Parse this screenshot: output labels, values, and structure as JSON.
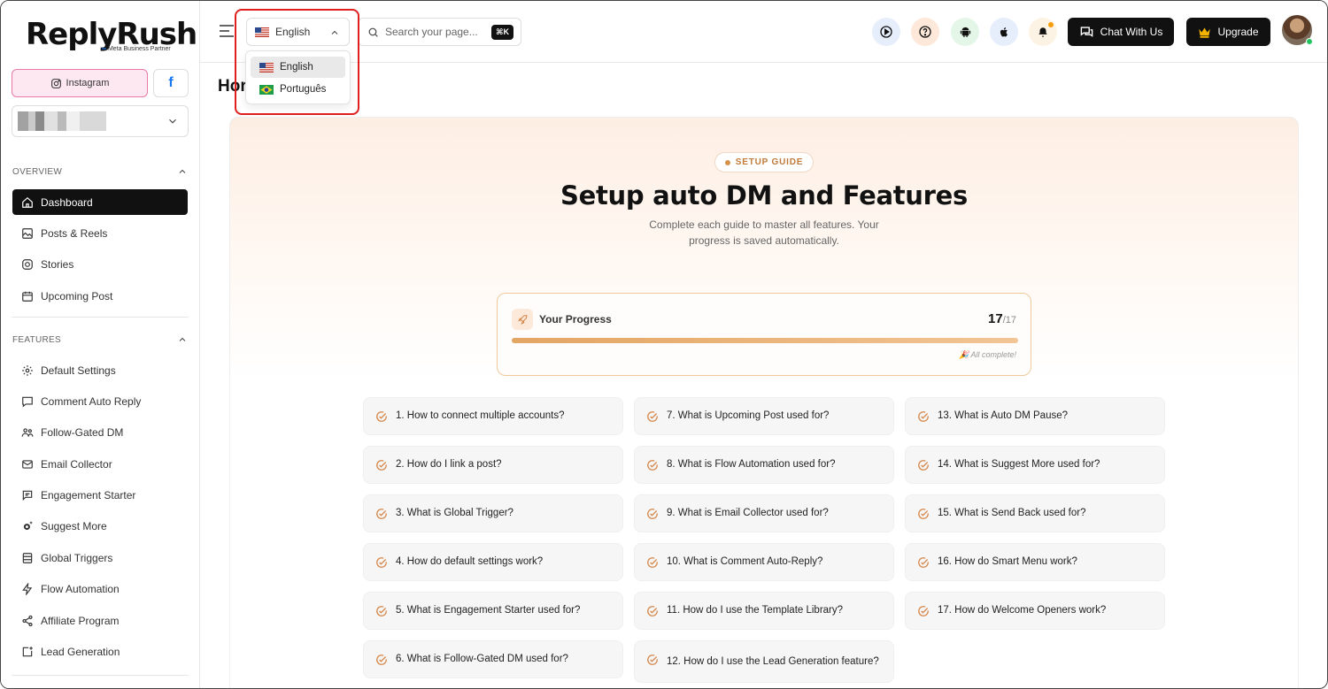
{
  "brand": {
    "name": "ReplyRush",
    "partner": "Meta Business Partner",
    "partner_mark": "∞"
  },
  "sidebar": {
    "instagram_label": "Instagram",
    "facebook_label": "f",
    "overview_header": "OVERVIEW",
    "features_header": "FEATURES",
    "overview_items": [
      {
        "label": "Dashboard",
        "icon": "home-icon",
        "active": true
      },
      {
        "label": "Posts & Reels",
        "icon": "image-icon"
      },
      {
        "label": "Stories",
        "icon": "instagram-icon"
      },
      {
        "label": "Upcoming Post",
        "icon": "calendar-icon"
      }
    ],
    "feature_items": [
      {
        "label": "Default Settings",
        "icon": "gear-icon"
      },
      {
        "label": "Comment Auto Reply",
        "icon": "comment-icon"
      },
      {
        "label": "Follow-Gated DM",
        "icon": "users-icon"
      },
      {
        "label": "Email Collector",
        "icon": "mail-icon"
      },
      {
        "label": "Engagement Starter",
        "icon": "message-icon"
      },
      {
        "label": "Suggest More",
        "icon": "sparkle-gear-icon"
      },
      {
        "label": "Global Triggers",
        "icon": "list-icon"
      },
      {
        "label": "Flow Automation",
        "icon": "bolt-icon"
      },
      {
        "label": "Affiliate Program",
        "icon": "share-icon"
      },
      {
        "label": "Lead Generation",
        "icon": "add-square-icon"
      }
    ]
  },
  "topbar": {
    "language": "English",
    "search_placeholder": "Search your page...",
    "search_shortcut": "⌘K",
    "chat_label": "Chat With Us",
    "upgrade_label": "Upgrade",
    "icon_colors": {
      "play": "#e7eefb",
      "help": "#fde8d9",
      "android": "#e4f6e8",
      "apple": "#e6eefc",
      "bell": "#fdf3e4"
    }
  },
  "language_dropdown": {
    "options": [
      {
        "label": "English",
        "flag": "us-flag-icon",
        "selected": true
      },
      {
        "label": "Português",
        "flag": "br-flag-icon",
        "selected": false
      }
    ]
  },
  "main": {
    "page_title": "Hor",
    "guide_badge": "SETUP GUIDE",
    "title": "Setup auto DM and Features",
    "subtitle": "Complete each guide to master all features. Your progress is saved automatically.",
    "progress": {
      "label": "Your Progress",
      "done": "17",
      "total": "/17",
      "fraction": 1.0,
      "status": "All complete!",
      "status_icon": "🎉"
    },
    "guides": [
      "1. How to connect multiple accounts?",
      "2. How do I link a post?",
      "3. What is Global Trigger?",
      "4. How do default settings work?",
      "5. What is Engagement Starter used for?",
      "6. What is Follow-Gated DM used for?",
      "7. What is Upcoming Post used for?",
      "8. What is Flow Automation used for?",
      "9. What is Email Collector used for?",
      "10. What is Comment Auto-Reply?",
      "11. How do I use the Template Library?",
      "12. How do I use the Lead Generation feature?",
      "13. What is Auto DM Pause?",
      "14. What is Suggest More used for?",
      "15. What is Send Back used for?",
      "16. How do Smart Menu work?",
      "17. How do Welcome Openers work?"
    ]
  }
}
